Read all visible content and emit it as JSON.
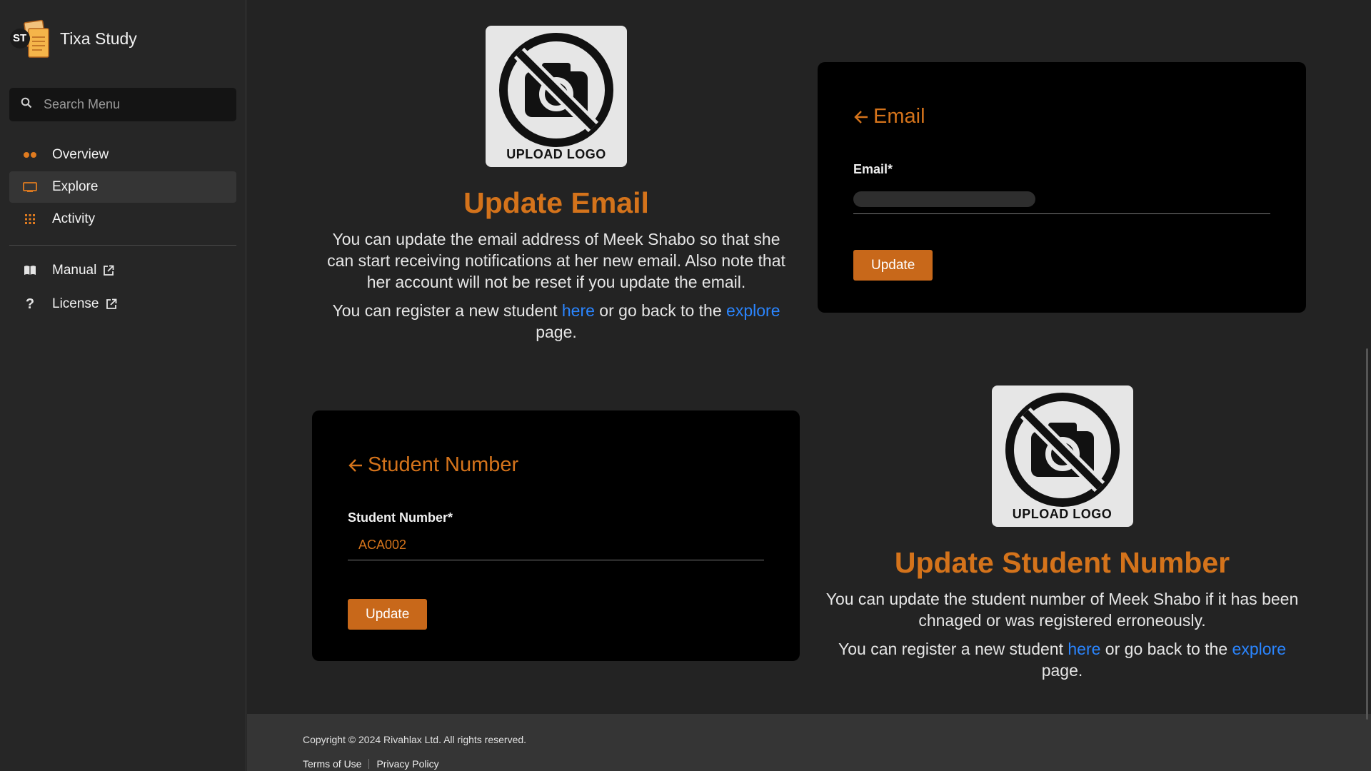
{
  "app": {
    "brand_initials": "ST",
    "name": "Tixa Study"
  },
  "search": {
    "placeholder": "Search Menu"
  },
  "nav": {
    "items": [
      {
        "label": "Overview",
        "icon": "dots-icon"
      },
      {
        "label": "Explore",
        "icon": "monitor-icon",
        "active": true
      },
      {
        "label": "Activity",
        "icon": "grid-icon"
      }
    ],
    "external": [
      {
        "label": "Manual",
        "icon": "book-icon"
      },
      {
        "label": "License",
        "icon": "question-icon"
      }
    ]
  },
  "email_section": {
    "logo_text": "UPLOAD LOGO",
    "title": "Update Email",
    "description": "You can update the email address of Meek Shabo so that she can start receiving notifications at her new email. Also note that her account will not be reset if you update the email.",
    "register_prefix": "You can register a new student ",
    "here_link": "here",
    "register_middle": " or go back to the ",
    "explore_link": "explore",
    "register_suffix": " page.",
    "card_title": "Email",
    "field_label": "Email*",
    "button": "Update"
  },
  "student_section": {
    "logo_text": "UPLOAD LOGO",
    "title": "Update Student Number",
    "description": "You can update the student number of Meek Shabo if it has been chnaged or was registered erroneously.",
    "register_prefix": "You can register a new student ",
    "here_link": "here",
    "register_middle": " or go back to the ",
    "explore_link": "explore",
    "register_suffix": " page.",
    "card_title": "Student Number",
    "field_label": "Student Number*",
    "field_value": "ACA002",
    "button": "Update"
  },
  "footer": {
    "copyright": "Copyright © 2024 Rivahlax Ltd. All rights reserved.",
    "terms": "Terms of Use",
    "privacy": "Privacy Policy"
  },
  "colors": {
    "accent": "#d4731b",
    "button": "#c8681a",
    "link": "#2a85ff",
    "background": "#232323",
    "card": "#000000"
  }
}
